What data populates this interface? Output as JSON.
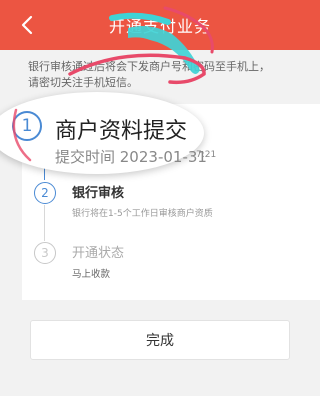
{
  "header": {
    "title": "开通支付业务",
    "back_icon": "chevron-left-icon"
  },
  "notice": {
    "line1": "银行审核通过后将会下发商户号和密码至手机上，",
    "line2": "请密切关注手机短信。"
  },
  "steps": [
    {
      "number": "1",
      "title": "商户资料提交",
      "time_label": "提交时间 2023-01-31",
      "time_tail": "7:21",
      "state": "done"
    },
    {
      "number": "2",
      "title": "银行审核",
      "desc": "银行将在1-5个工作日审核商户资质",
      "state": "current"
    },
    {
      "number": "3",
      "title": "开通状态",
      "desc": "马上收款",
      "state": "pending"
    }
  ],
  "done_button": "完成",
  "colors": {
    "header": "#ec5542",
    "step_blue": "#4a8ad4",
    "scribble_cyan": "#3fd3d6",
    "scribble_red": "#e84a6a"
  }
}
